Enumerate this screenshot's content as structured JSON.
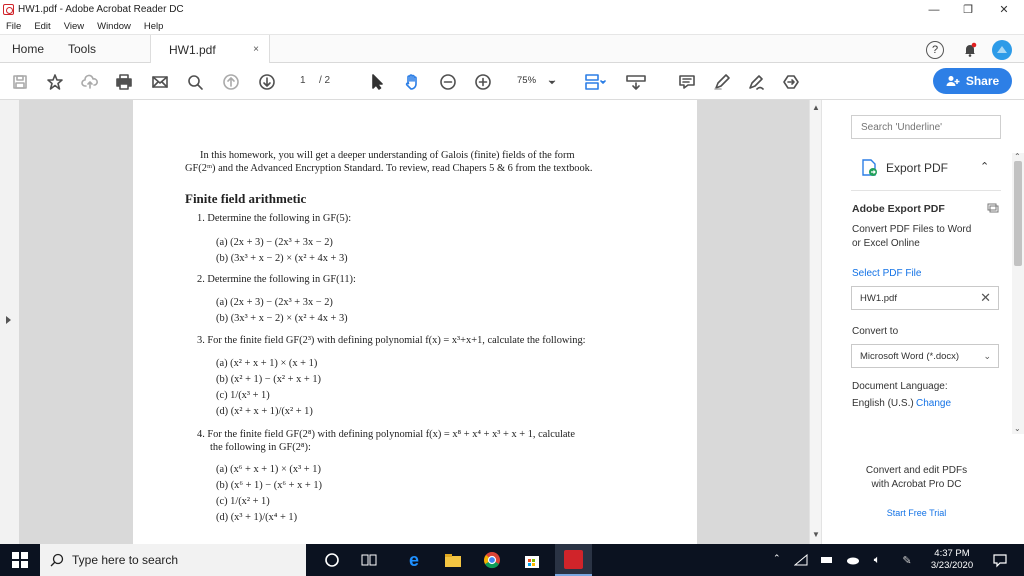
{
  "window": {
    "title": "HW1.pdf - Adobe Acrobat Reader DC",
    "controls": [
      "—",
      "❐",
      "✕"
    ]
  },
  "menu": [
    "File",
    "Edit",
    "View",
    "Window",
    "Help"
  ],
  "tabs": {
    "home": "Home",
    "tools": "Tools",
    "doc": "HW1.pdf",
    "close": "×"
  },
  "toolbar": {
    "page_current": "1",
    "page_total": "/ 2",
    "zoom": "75%",
    "share_label": "Share"
  },
  "document": {
    "intro": [
      "In this homework, you will get a deeper understanding of Galois (finite) fields of the form",
      "GF(2ᵐ) and the Advanced Encryption Standard. To review, read Chapers 5 & 6 from the textbook."
    ],
    "heading": "Finite field arithmetic",
    "lines": [
      "1. Determine the following in GF(5):",
      "(a) (2x + 3) − (2x³ + 3x − 2)",
      "(b) (3x³ + x − 2) × (x² + 4x + 3)",
      "2. Determine the following in GF(11):",
      "(a) (2x + 3) − (2x³ + 3x − 2)",
      "(b) (3x³ + x − 2) × (x² + 4x + 3)",
      "3. For the finite field GF(2³) with defining polynomial f(x) = x³+x+1, calculate the following:",
      "(a) (x² + x + 1) × (x + 1)",
      "(b) (x² + 1) − (x² + x + 1)",
      "(c) 1/(x³ + 1)",
      "(d) (x² + x + 1)/(x² + 1)",
      "4. For the finite field GF(2⁸) with defining polynomial f(x) = x⁸ + x⁴ + x³ + x + 1, calculate",
      "the following in GF(2⁸):",
      "(a) (x⁶ + x + 1) × (x³ + 1)",
      "(b) (x⁶ + 1) − (x⁶ + x + 1)",
      "(c) 1/(x² + 1)",
      "(d) (x³ + 1)/(x⁴ + 1)"
    ]
  },
  "right_pane": {
    "search_placeholder": "Search 'Underline'",
    "export_title": "Export PDF",
    "adobe_export": "Adobe Export PDF",
    "convert_desc_1": "Convert PDF Files to Word",
    "convert_desc_2": "or Excel Online",
    "select_file": "Select PDF File",
    "file_name": "HW1.pdf",
    "convert_to": "Convert to",
    "format": "Microsoft Word (*.docx)",
    "doc_language": "Document Language:",
    "language_value": "English (U.S.)",
    "change": "Change",
    "promo_1": "Convert and edit PDFs",
    "promo_2": "with Acrobat Pro DC",
    "trial": "Start Free Trial"
  },
  "taskbar": {
    "search": "Type here to search",
    "time": "4:37 PM",
    "date": "3/23/2020"
  },
  "colors": {
    "accent": "#2d7fe6",
    "acrobat_red": "#d0242a",
    "taskbar": "#0b1220"
  }
}
